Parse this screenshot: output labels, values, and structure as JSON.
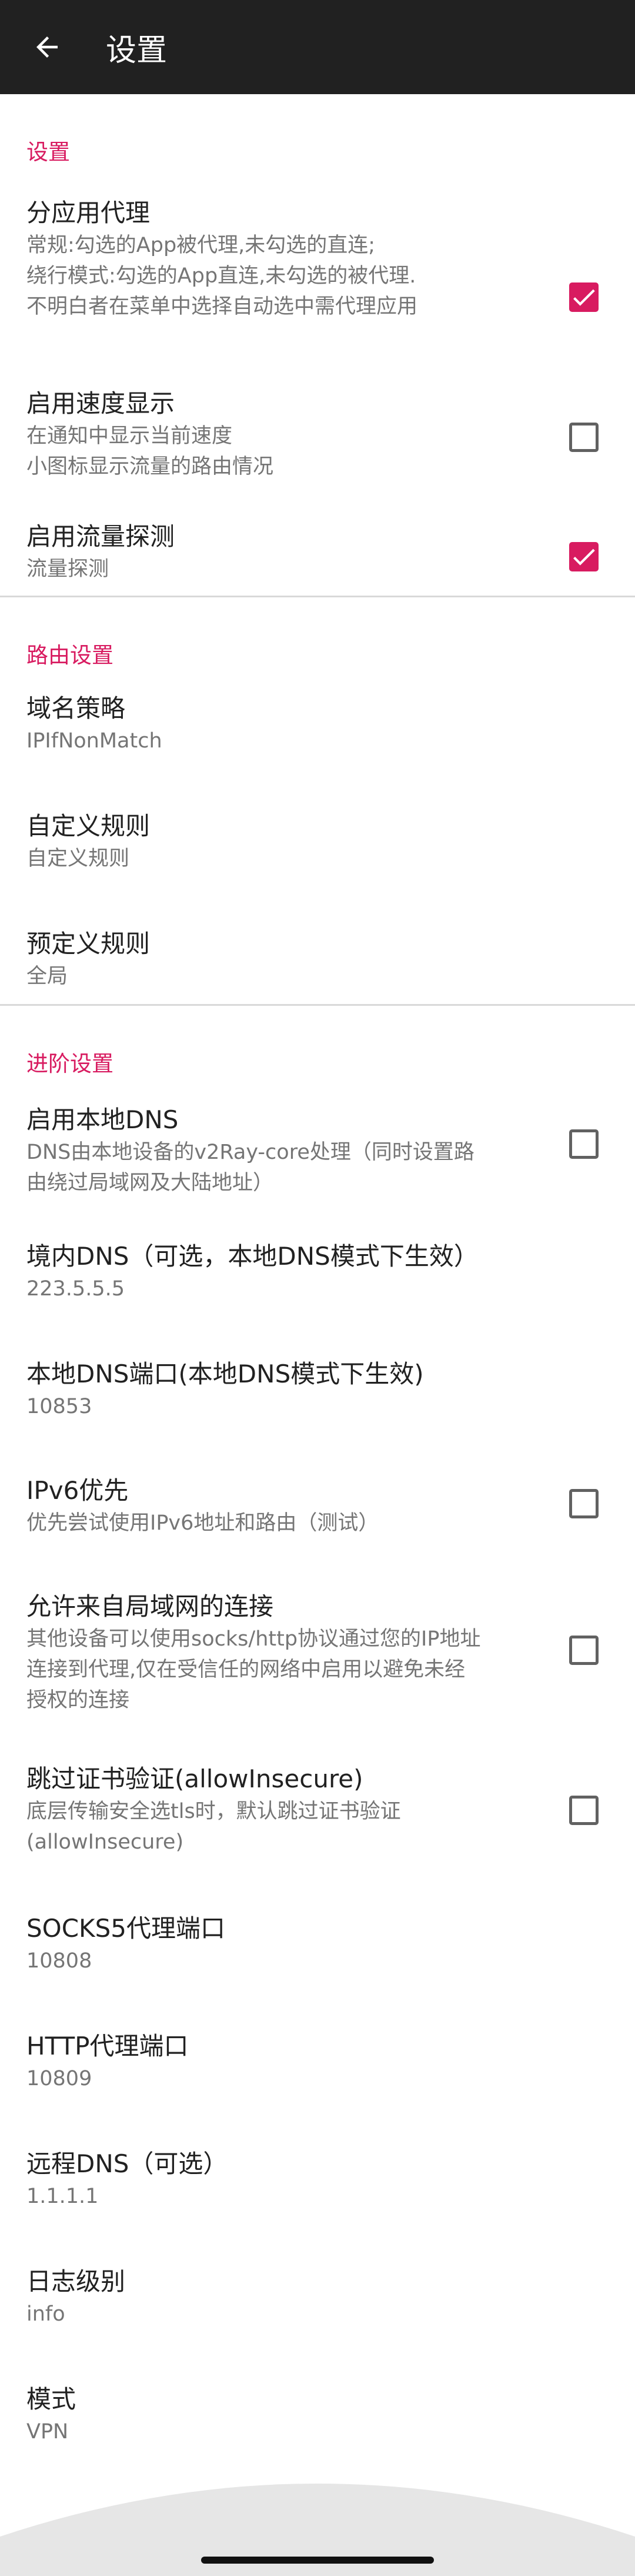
{
  "appbar": {
    "title": "设置"
  },
  "sections": {
    "general": {
      "header": "设置",
      "per_app_proxy": {
        "title": "分应用代理",
        "summary": "常规:勾选的App被代理,未勾选的直连;\n绕行模式:勾选的App直连,未勾选的被代理.\n不明白者在菜单中选择自动选中需代理应用",
        "checked": true
      },
      "speed_display": {
        "title": "启用速度显示",
        "summary": "在通知中显示当前速度\n小图标显示流量的路由情况",
        "checked": false
      },
      "sniffing": {
        "title": "启用流量探测",
        "summary": "流量探测",
        "checked": true
      }
    },
    "routing": {
      "header": "路由设置",
      "domain_strategy": {
        "title": "域名策略",
        "summary": "IPIfNonMatch"
      },
      "custom_rules": {
        "title": "自定义规则",
        "summary": "自定义规则"
      },
      "predefined_rules": {
        "title": "预定义规则",
        "summary": "全局"
      }
    },
    "advanced": {
      "header": "进阶设置",
      "local_dns": {
        "title": "启用本地DNS",
        "summary": "DNS由本地设备的v2Ray-core处理（同时设置路\n由绕过局域网及大陆地址）",
        "checked": false
      },
      "domestic_dns": {
        "title": "境内DNS（可选，本地DNS模式下生效）",
        "summary": "223.5.5.5"
      },
      "local_dns_port": {
        "title": "本地DNS端口(本地DNS模式下生效)",
        "summary": "10853"
      },
      "ipv6": {
        "title": "IPv6优先",
        "summary": "优先尝试使用IPv6地址和路由（测试）",
        "checked": false
      },
      "allow_lan": {
        "title": "允许来自局域网的连接",
        "summary": "其他设备可以使用socks/http协议通过您的IP地址\n连接到代理,仅在受信任的网络中启用以避免未经\n授权的连接",
        "checked": false
      },
      "allow_insecure": {
        "title": "跳过证书验证(allowInsecure)",
        "summary": "底层传输安全选tls时，默认跳过证书验证\n(allowInsecure)",
        "checked": false
      },
      "socks_port": {
        "title": "SOCKS5代理端口",
        "summary": "10808"
      },
      "http_port": {
        "title": "HTTP代理端口",
        "summary": "10809"
      },
      "remote_dns": {
        "title": "远程DNS（可选）",
        "summary": "1.1.1.1"
      },
      "log_level": {
        "title": "日志级别",
        "summary": "info"
      },
      "mode": {
        "title": "模式",
        "summary": "VPN"
      }
    }
  },
  "colors": {
    "appbar": "#212121",
    "accent": "#d81b60",
    "summary_text": "#757575"
  },
  "icons": {
    "back": "arrow-left-icon",
    "checkbox_checked": "check-icon"
  }
}
